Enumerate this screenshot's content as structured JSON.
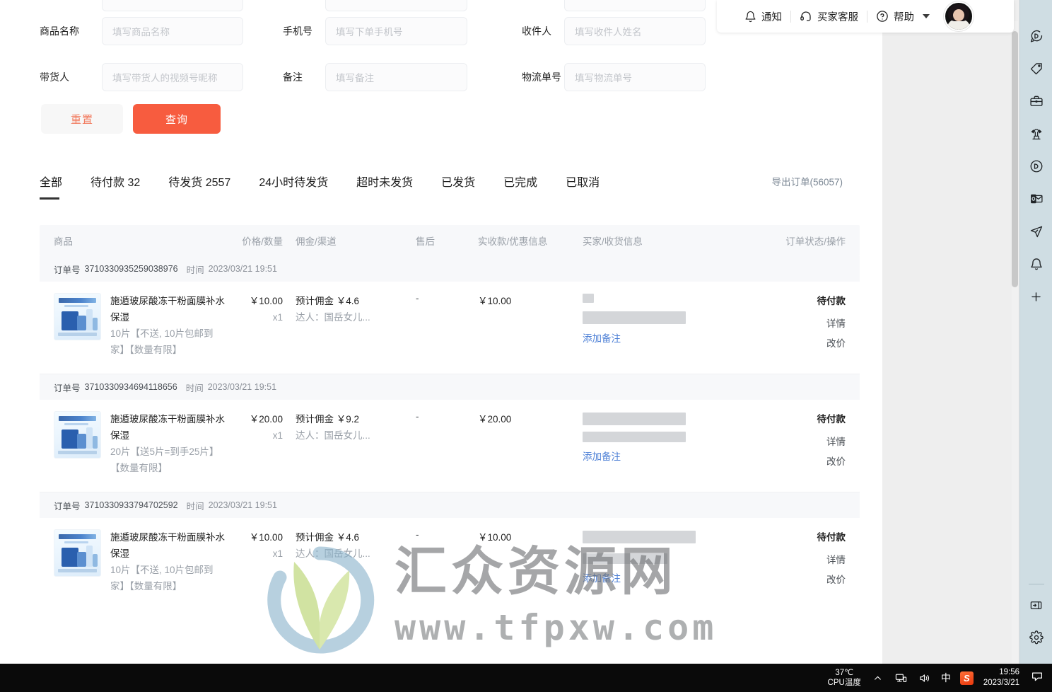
{
  "header": {
    "notification_label": "通知",
    "service_label": "买家客服",
    "help_label": "帮助"
  },
  "search_form": {
    "rows": [
      {
        "fields": [
          {
            "label": "商品名称",
            "placeholder": "填写商品名称"
          },
          {
            "label": "手机号",
            "placeholder": "填写下单手机号"
          },
          {
            "label": "收件人",
            "placeholder": "填写收件人姓名"
          }
        ]
      },
      {
        "fields": [
          {
            "label": "带货人",
            "placeholder": "填写带货人的视频号昵称"
          },
          {
            "label": "备注",
            "placeholder": "填写备注"
          },
          {
            "label": "物流单号",
            "placeholder": "填写物流单号"
          }
        ]
      }
    ],
    "reset_label": "重置",
    "query_label": "查询"
  },
  "tabs": [
    {
      "label": "全部",
      "active": true
    },
    {
      "label": "待付款 32",
      "active": false
    },
    {
      "label": "待发货 2557",
      "active": false
    },
    {
      "label": "24小时待发货",
      "active": false
    },
    {
      "label": "超时未发货",
      "active": false
    },
    {
      "label": "已发货",
      "active": false
    },
    {
      "label": "已完成",
      "active": false
    },
    {
      "label": "已取消",
      "active": false
    }
  ],
  "export_label": "导出订单(56057)",
  "table": {
    "columns": {
      "product": "商品",
      "price_qty": "价格/数量",
      "commission_channel": "佣金/渠道",
      "after_sale": "售后",
      "paid_discount": "实收款/优惠信息",
      "buyer_delivery": "买家/收货信息",
      "status_action": "订单状态/操作"
    },
    "order_no_prefix": "订单号",
    "time_prefix": "时间",
    "add_note_label": "添加备注",
    "detail_label": "详情",
    "modify_price_label": "改价",
    "orders": [
      {
        "order_no": "3710330935259038976",
        "time": "2023/03/21 19:51",
        "product_name": "施遁玻尿酸冻干粉面膜补水保湿",
        "product_spec": "10片【不送, 10片包邮到家】【数量有限】",
        "price": "￥10.00",
        "qty": "x1",
        "commission_label": "预计佣金",
        "commission": "￥4.6",
        "daren": "达人：国岳女儿...",
        "after_sale": "-",
        "paid": "￥10.00",
        "status": "待付款"
      },
      {
        "order_no": "3710330934694118656",
        "time": "2023/03/21 19:51",
        "product_name": "施遁玻尿酸冻干粉面膜补水保湿",
        "product_spec": "20片【送5片=到手25片】【数量有限】",
        "price": "￥20.00",
        "qty": "x1",
        "commission_label": "预计佣金",
        "commission": "￥9.2",
        "daren": "达人：国岳女儿...",
        "after_sale": "-",
        "paid": "￥20.00",
        "status": "待付款"
      },
      {
        "order_no": "3710330933794702592",
        "time": "2023/03/21 19:51",
        "product_name": "施遁玻尿酸冻干粉面膜补水保湿",
        "product_spec": "10片【不送, 10片包邮到家】【数量有限】",
        "price": "￥10.00",
        "qty": "x1",
        "commission_label": "预计佣金",
        "commission": "￥4.6",
        "daren": "达人：国岳女儿...",
        "after_sale": "-",
        "paid": "￥10.00",
        "status": "待付款"
      }
    ]
  },
  "watermark": {
    "text_cn": "汇众资源网",
    "text_url": "www.tfpxw.com"
  },
  "taskbar": {
    "temperature": "37℃",
    "temperature_label": "CPU温度",
    "ime": "中",
    "sogou": "S",
    "time": "19:56",
    "date": "2023/3/21"
  },
  "colors": {
    "accent": "#f75c3f",
    "link": "#4c7fd6",
    "sidebar": "#cfdde3"
  }
}
